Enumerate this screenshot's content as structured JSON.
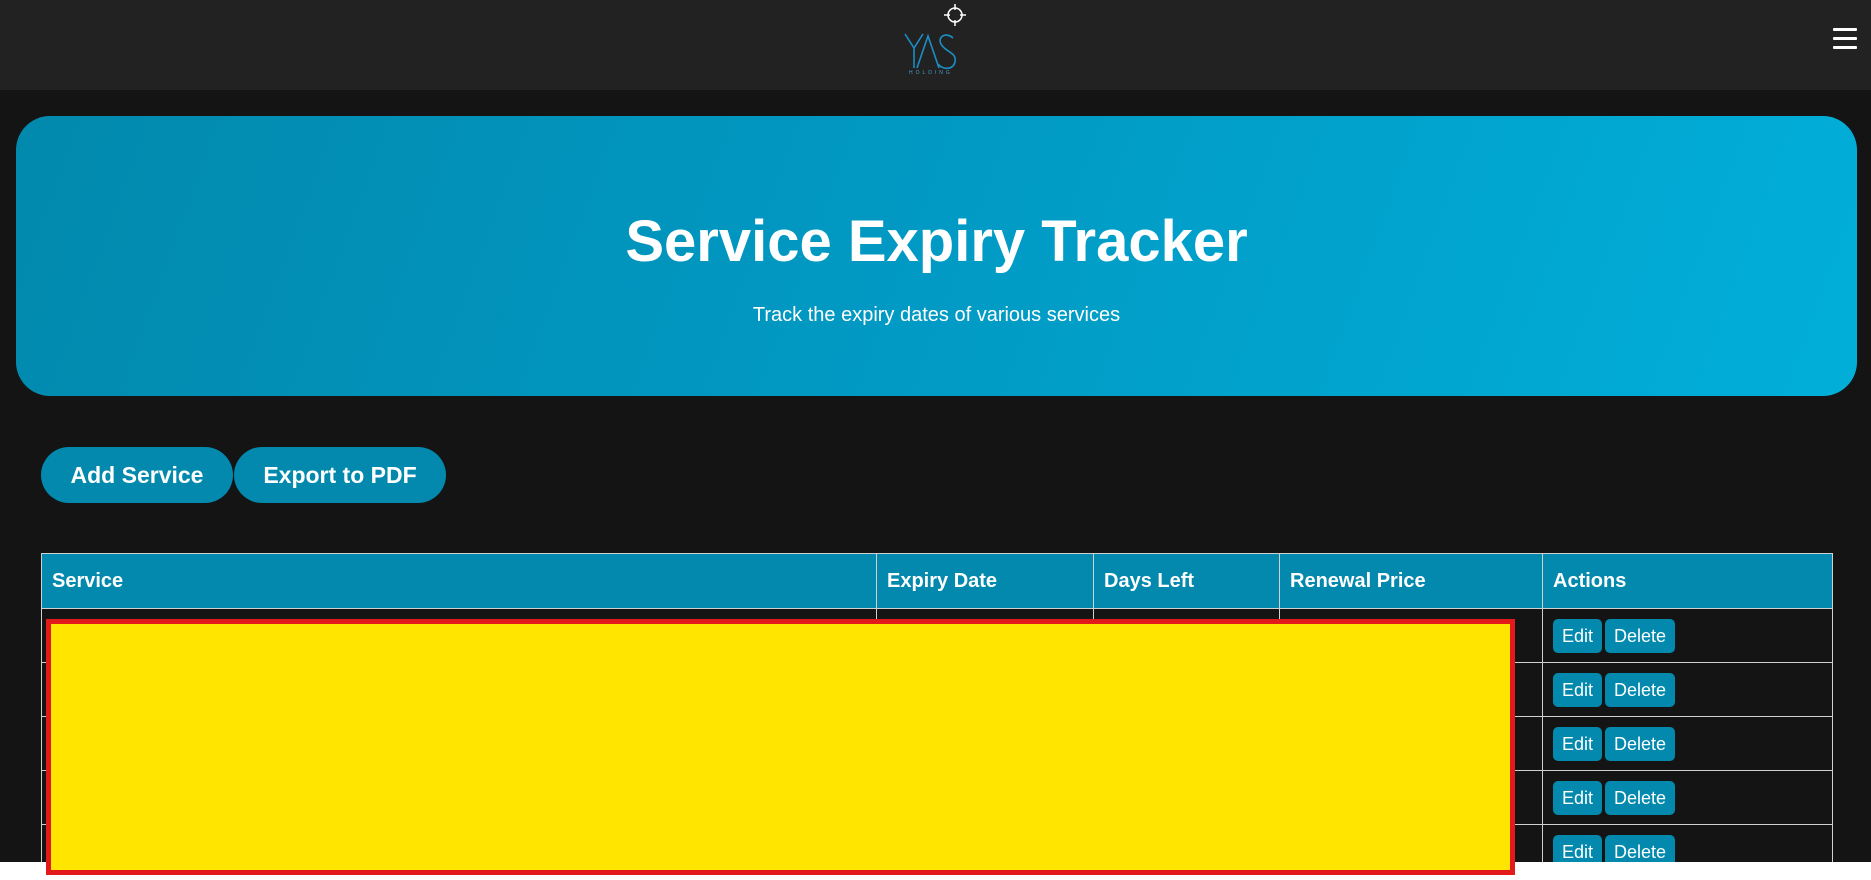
{
  "header": {
    "logo_text": "YAS",
    "logo_subtext": "HOLDING",
    "menu_icon": "hamburger-menu-icon"
  },
  "hero": {
    "title": "Service Expiry Tracker",
    "subtitle": "Track the expiry dates of various services"
  },
  "toolbar": {
    "add_label": "Add Service",
    "export_label": "Export to PDF"
  },
  "table": {
    "columns": [
      "Service",
      "Expiry Date",
      "Days Left",
      "Renewal Price",
      "Actions"
    ],
    "rows": [
      {
        "edit_label": "Edit",
        "delete_label": "Delete"
      },
      {
        "edit_label": "Edit",
        "delete_label": "Delete"
      },
      {
        "edit_label": "Edit",
        "delete_label": "Delete"
      },
      {
        "edit_label": "Edit",
        "delete_label": "Delete"
      },
      {
        "edit_label": "Edit",
        "delete_label": "Delete"
      }
    ]
  },
  "colors": {
    "accent": "#0289ad",
    "background": "#141414",
    "header": "#222222",
    "redaction_fill": "#ffe500",
    "redaction_border": "#e31a1a"
  }
}
